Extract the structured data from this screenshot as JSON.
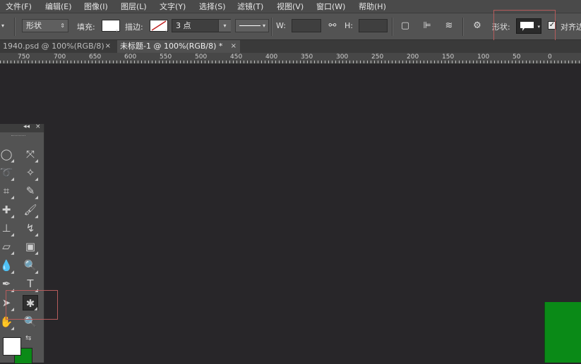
{
  "menu": [
    "文件(F)",
    "编辑(E)",
    "图像(I)",
    "图层(L)",
    "文字(Y)",
    "选择(S)",
    "滤镜(T)",
    "视图(V)",
    "窗口(W)",
    "帮助(H)"
  ],
  "options": {
    "mode_select": "形状",
    "fill_label": "填充:",
    "stroke_label": "描边:",
    "stroke_width": "3 点",
    "w_label": "W:",
    "h_label": "H:",
    "shape_label": "形状:",
    "align_label": "对齐边"
  },
  "tabs": [
    {
      "label": "1940.psd @ 100%(RGB/8)",
      "close": "×",
      "active": false
    },
    {
      "label": "未标题-1 @ 100%(RGB/8) *",
      "close": "×",
      "active": true
    }
  ],
  "ruler_ticks": [
    "750",
    "700",
    "650",
    "600",
    "550",
    "500",
    "450",
    "400",
    "350",
    "300",
    "250",
    "200",
    "150",
    "100",
    "50",
    "0"
  ],
  "toolpanel": {
    "collapse": "◂◂",
    "close": "×"
  },
  "colors": {
    "foreground": "#ffffff",
    "background": "#0b8a17",
    "canvas": "#282629",
    "highlight": "#b55c5c"
  }
}
